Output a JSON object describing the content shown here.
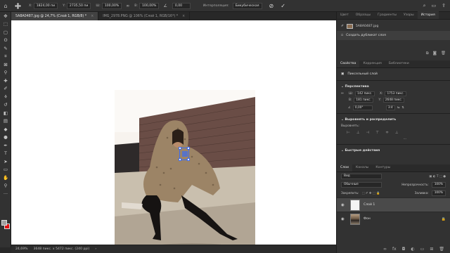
{
  "options_bar": {
    "x_label": "X:",
    "x_value": "1824,00 пи",
    "y_label": "Y:",
    "y_value": "2735,50 пи",
    "w_label": "Ш:",
    "w_value": "100,00%",
    "h_label": "В:",
    "h_value": "100,00%",
    "angle_value": "0,00",
    "interp_label": "Интерполяция:",
    "interp_value": "Бикубическая",
    "cancel_icon": "⊘",
    "commit_icon": "✓"
  },
  "tabs": [
    {
      "label": "5A8A0487.jpg @ 24,7% (Слой 1, RGB/8) *",
      "close": "×"
    },
    {
      "label": "IMG_2978.PNG @ 106% (Слой 1, RGB/16*) *",
      "close": "×"
    }
  ],
  "status": {
    "zoom": "24,69%",
    "doc": "3648 пикс. x 5472 пикс. (240 ppi)",
    "arrow": "›"
  },
  "panel": {
    "top_tabs": [
      "Цвет",
      "Образцы",
      "Градиенты",
      "Узоры",
      "История"
    ],
    "history": [
      {
        "label": "5A8A0487.jpg"
      },
      {
        "label": "Создать дубликат слоя"
      }
    ],
    "props_tabs": [
      "Свойства",
      "Коррекция",
      "Библиотеки"
    ],
    "pixel_layer": "Пиксельный слой",
    "transform_section": "Перспектива",
    "transform": {
      "w_label": "Ш:",
      "w_value": "142 пикс.",
      "x_label": "X:",
      "x_value": "1753 пикс.",
      "h_label": "В:",
      "h_value": "181 пикс.",
      "y_label": "Y:",
      "y_value": "2648 пикс.",
      "angle_value": "0,00°",
      "flip_label": "3:4"
    },
    "align_section": "Выровнять и распределить",
    "align_label": "Выровнять:",
    "more": "···",
    "quick_section": "Быстрые действия",
    "layers_tabs": [
      "Слои",
      "Каналы",
      "Контуры"
    ],
    "kind_value": "Вид",
    "blend_value": "Обычные",
    "opacity_label": "Непрозрачность:",
    "opacity_value": "100%",
    "lock_label": "Закрепить:",
    "fill_label": "Заливка:",
    "fill_value": "100%",
    "layers": [
      {
        "name": "Слой 1"
      },
      {
        "name": "Фон"
      }
    ]
  }
}
